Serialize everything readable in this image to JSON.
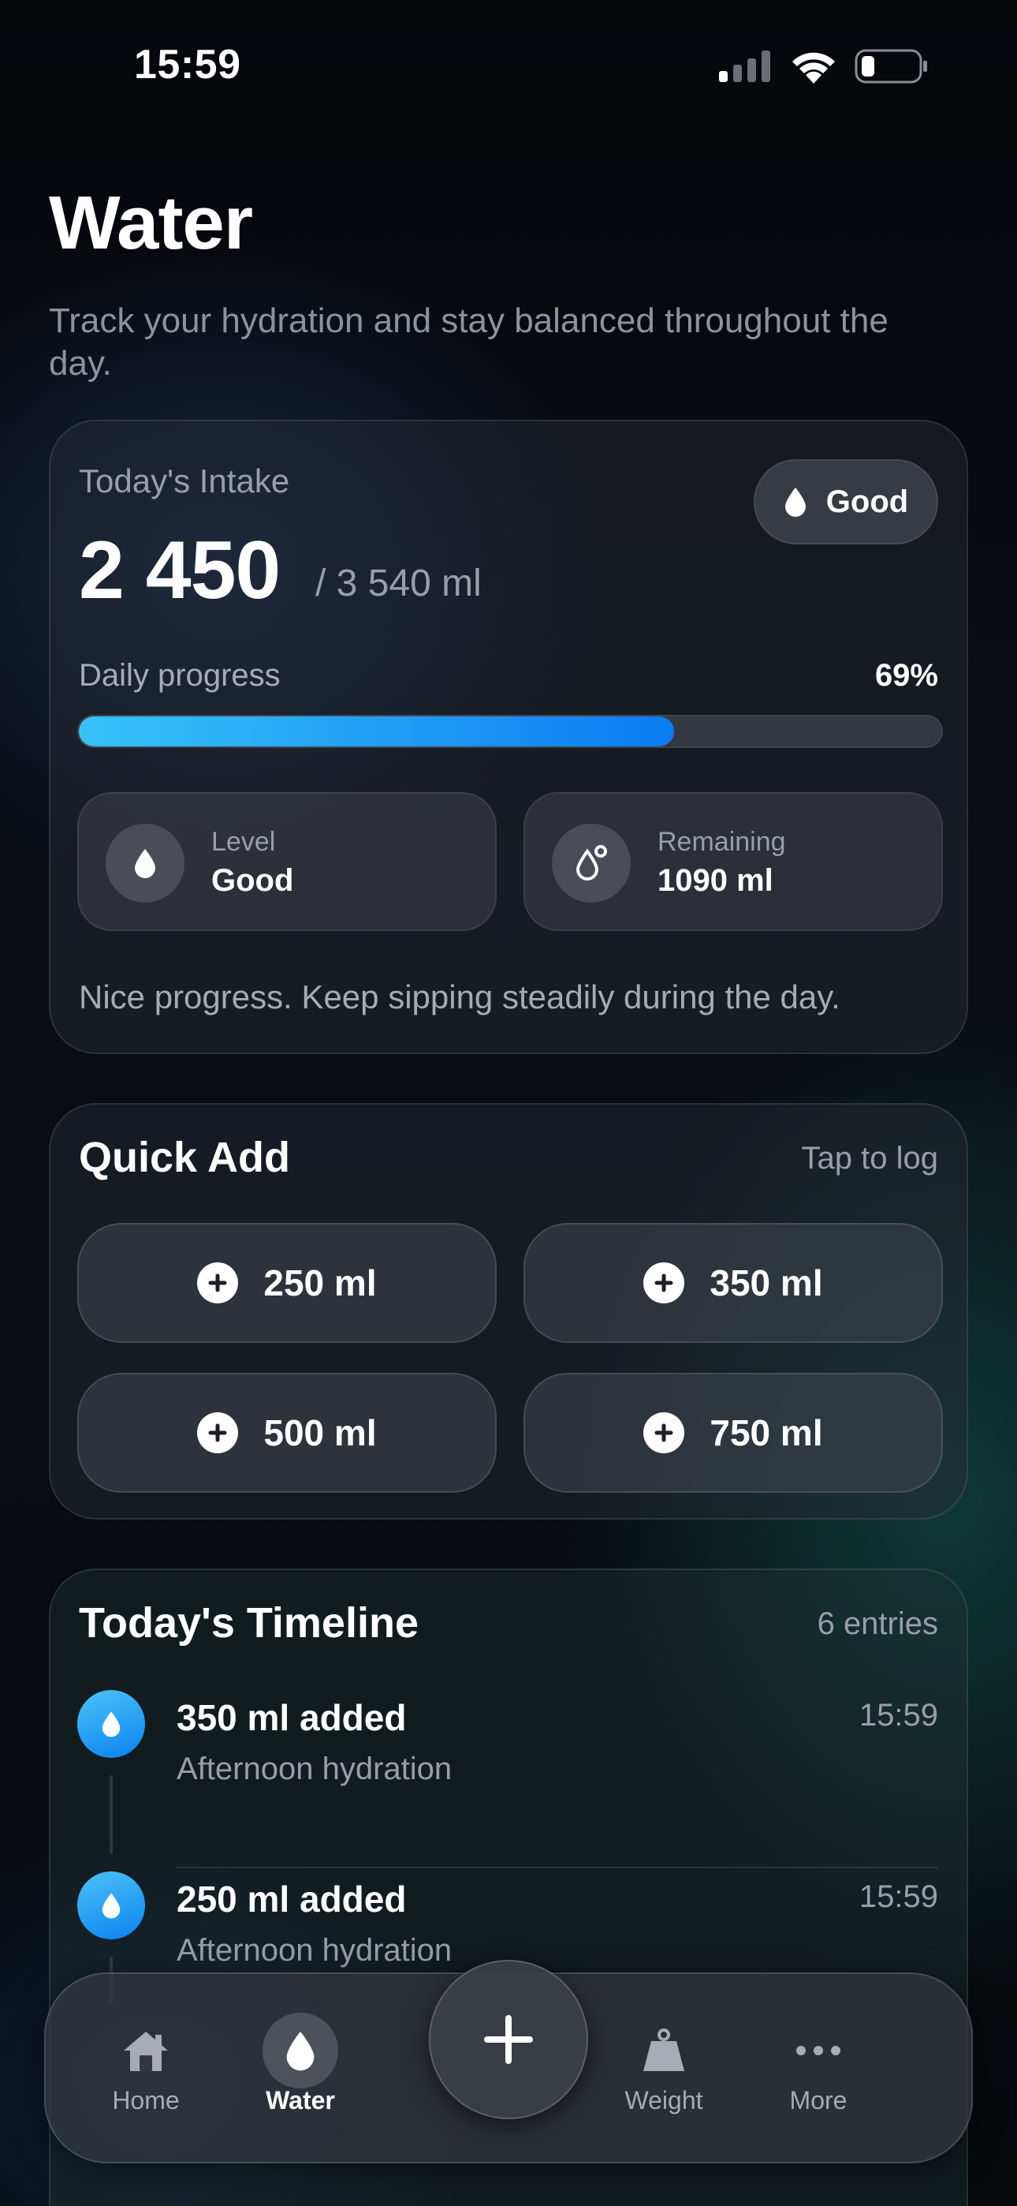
{
  "status_bar": {
    "time": "15:59"
  },
  "header": {
    "title": "Water",
    "subtitle": "Track your hydration and stay balanced throughout the day."
  },
  "intake": {
    "label": "Today's Intake",
    "amount": "2 450",
    "goal": "/ 3 540 ml",
    "status_badge": "Good",
    "progress_label": "Daily progress",
    "progress_percent_text": "69%",
    "progress_percent": 69,
    "level_label": "Level",
    "level_value": "Good",
    "remaining_label": "Remaining",
    "remaining_value": "1090 ml",
    "message": "Nice progress. Keep sipping steadily during the day."
  },
  "quick_add": {
    "title": "Quick Add",
    "hint": "Tap to log",
    "buttons": [
      "250 ml",
      "350 ml",
      "500 ml",
      "750 ml"
    ]
  },
  "timeline": {
    "title": "Today's Timeline",
    "count": "6 entries",
    "entries": [
      {
        "title": "350 ml added",
        "subtitle": "Afternoon hydration",
        "time": "15:59"
      },
      {
        "title": "250 ml added",
        "subtitle": "Afternoon hydration",
        "time": "15:59"
      }
    ]
  },
  "tab_bar": {
    "tabs": [
      "Home",
      "Water",
      "Weight",
      "More"
    ],
    "active": "Water"
  },
  "colors": {
    "accent_start": "#39c2f7",
    "accent_end": "#0a7cf2",
    "background": "#07080c"
  },
  "icons": [
    "cellular-icon",
    "wifi-icon",
    "battery-icon",
    "water-drop-icon",
    "drops-icon",
    "plus-icon",
    "home-icon",
    "weight-icon",
    "more-icon"
  ]
}
